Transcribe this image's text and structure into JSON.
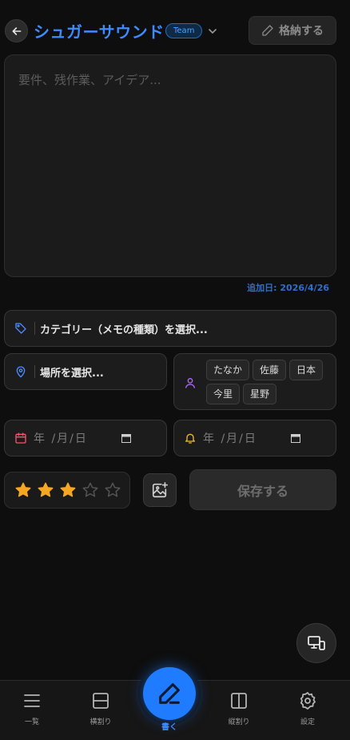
{
  "header": {
    "title": "シュガーサウンド",
    "team_badge": "Team",
    "archive_label": "格納する"
  },
  "memo": {
    "placeholder": "要件、残作業、アイデア...",
    "added_date": "追加日: 2026/4/26"
  },
  "fields": {
    "category_label": "カテゴリー（メモの種類）を選択...",
    "location_label": "場所を選択...",
    "people": [
      "たなか",
      "佐藤",
      "日本",
      "今里",
      "星野"
    ],
    "date_placeholder": "年 /月/日",
    "reminder_placeholder": "年 /月/日"
  },
  "rating": {
    "value": 3,
    "max": 5
  },
  "actions": {
    "save_label": "保存する"
  },
  "bottom_nav": {
    "items": [
      {
        "label": "一覧"
      },
      {
        "label": "横割り"
      },
      {
        "label": "書く"
      },
      {
        "label": "縦割り"
      },
      {
        "label": "設定"
      }
    ]
  },
  "colors": {
    "accent": "#1f7bff",
    "star_filled": "#f5a623",
    "category_icon": "#4a8cff",
    "person_icon": "#b36cff",
    "calendar_icon": "#ff4d6a",
    "bell_icon": "#f5b82e"
  }
}
